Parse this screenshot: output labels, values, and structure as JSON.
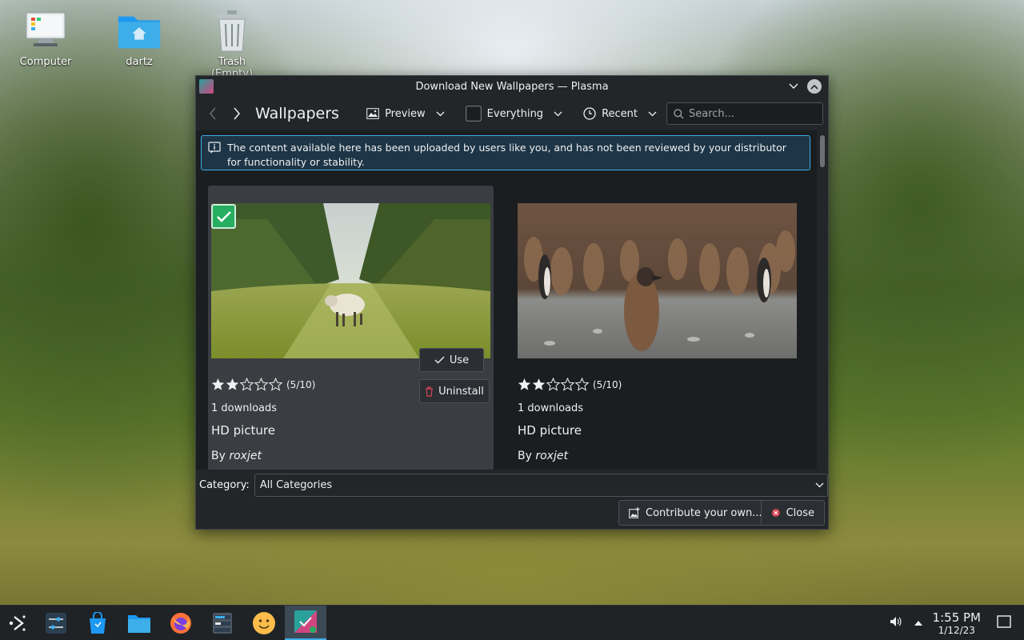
{
  "desktop": {
    "icons": [
      {
        "label": "Computer"
      },
      {
        "label": "dartz"
      },
      {
        "label": "Trash (Empty)"
      }
    ]
  },
  "dialog": {
    "title": "Download New Wallpapers — Plasma",
    "heading": "Wallpapers",
    "view_mode": "Preview",
    "filter": "Everything",
    "sort": "Recent",
    "search_placeholder": "Search...",
    "notice": "The content available here has been uploaded by users like you, and has not been reviewed by your distributor for functionality or stability.",
    "items": [
      {
        "rating_text": "(5/10)",
        "rating_value": 5,
        "downloads": "1 downloads",
        "name": "HD picture",
        "by_prefix": "By",
        "author": "roxjet",
        "installed": true,
        "use_label": "Use",
        "uninstall_label": "Uninstall",
        "image": "sheep-in-orchard"
      },
      {
        "rating_text": "(5/10)",
        "rating_value": 5,
        "downloads": "1 downloads",
        "name": "HD picture",
        "by_prefix": "By",
        "author": "roxjet",
        "installed": false,
        "image": "king-penguin-colony"
      }
    ],
    "category_label": "Category:",
    "category_value": "All Categories",
    "contribute_label": "Contribute your own...",
    "close_label": "Close"
  },
  "taskbar": {
    "time": "1:55 PM",
    "date": "1/12/23",
    "apps": [
      "application-launcher",
      "system-settings",
      "discover",
      "dolphin",
      "firefox",
      "system-monitor",
      "emoji-selector",
      "knewstuff"
    ]
  },
  "colors": {
    "accent": "#3daee9",
    "installed_check": "#27ae60",
    "window_bg": "#232629",
    "view_bg": "#1b1e20"
  }
}
